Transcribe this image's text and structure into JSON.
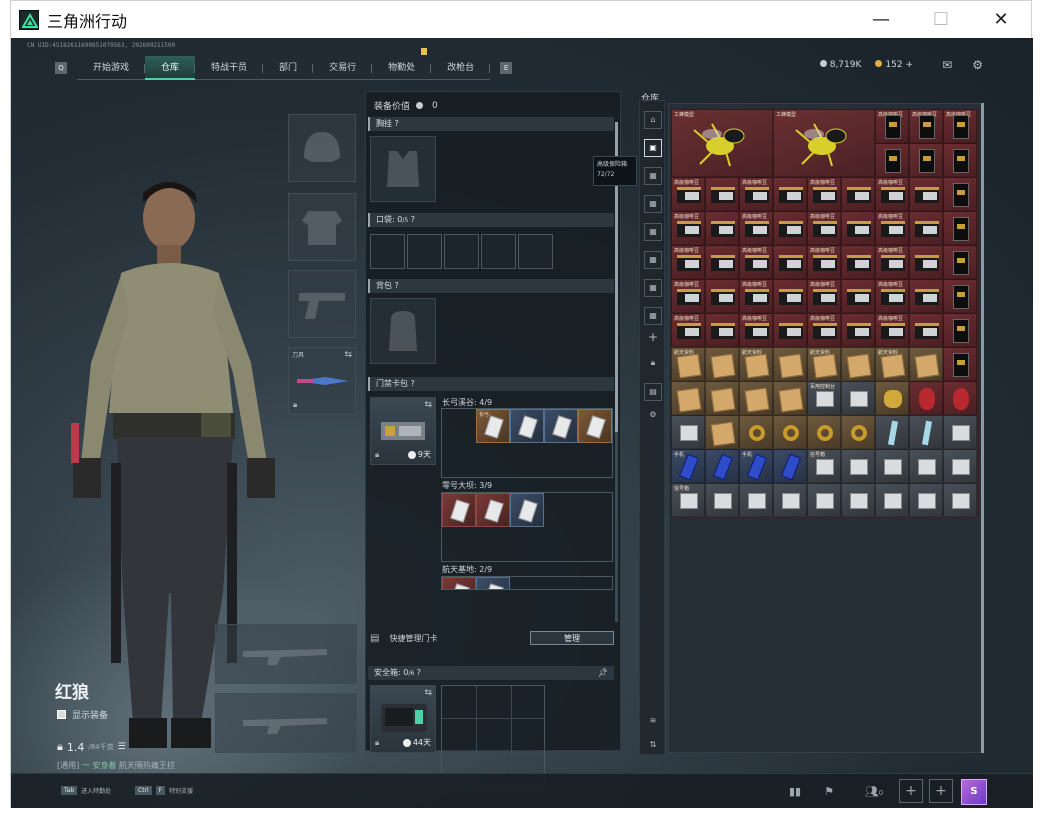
{
  "window": {
    "title": "三角洲行动",
    "minimize": "—",
    "maximize": "☐",
    "close": "✕"
  },
  "uid": "CN UID:45182611690851070563, 202609211500",
  "nav": {
    "left_key": "Q",
    "right_key": "E",
    "tabs": [
      "开始游戏",
      "仓库",
      "特战干员",
      "部门",
      "交易行",
      "物勤处",
      "改枪台"
    ],
    "active_index": 1
  },
  "currency": {
    "hafcoin": "8,719K",
    "tickets": "152",
    "plus": "+"
  },
  "character": {
    "name": "红狼",
    "show_gear": "显示装备",
    "weight": "1.4",
    "weight_max": "/84千克",
    "status_prefix": "[通用]",
    "status_green": "一 安身着",
    "status_rest": "航天隔热痛王拉"
  },
  "slots": {
    "knife_label": "刀具"
  },
  "mid": {
    "equip_value_label": "装备价值",
    "equip_value": "0",
    "chest_rig": "胸挂",
    "pocket": "口袋:",
    "pocket_value": "0",
    "pocket_max": "/5",
    "backpack": "背包",
    "keycard": "门禁卡包",
    "keycard_time": "9天",
    "area1": "长弓溪谷: 4/9",
    "area2": "零号大坝: 3/9",
    "area3": "航天基地: 2/9",
    "quick_manage": "快捷管理门卡",
    "manage_btn": "管理",
    "safe_box": "安全箱:",
    "safe_value": "0",
    "safe_max": "/6",
    "safe_time": "44天"
  },
  "tooltip": {
    "line1": "高级保险箱",
    "line2": "72/72"
  },
  "warehouse": {
    "title": "仓库",
    "labels": {
      "wasp": "工蜂模型",
      "coffee": "高级咖啡豆",
      "doc": "航天资料",
      "phone": "手机",
      "big": "军用控制台",
      "box": "信号箱"
    }
  },
  "bottom": {
    "tab_key": "Tab",
    "tab_hint": "进入特勤处",
    "ctrl_key": "Ctrl",
    "ctrl_key2": "F",
    "ctrl_hint": "特别支援",
    "friends": "0",
    "avatar_letter": "S"
  },
  "colors": {
    "accent": "#4fd1a7",
    "warehouse_bg": "#3a2226",
    "gold": "#c89b3c"
  }
}
